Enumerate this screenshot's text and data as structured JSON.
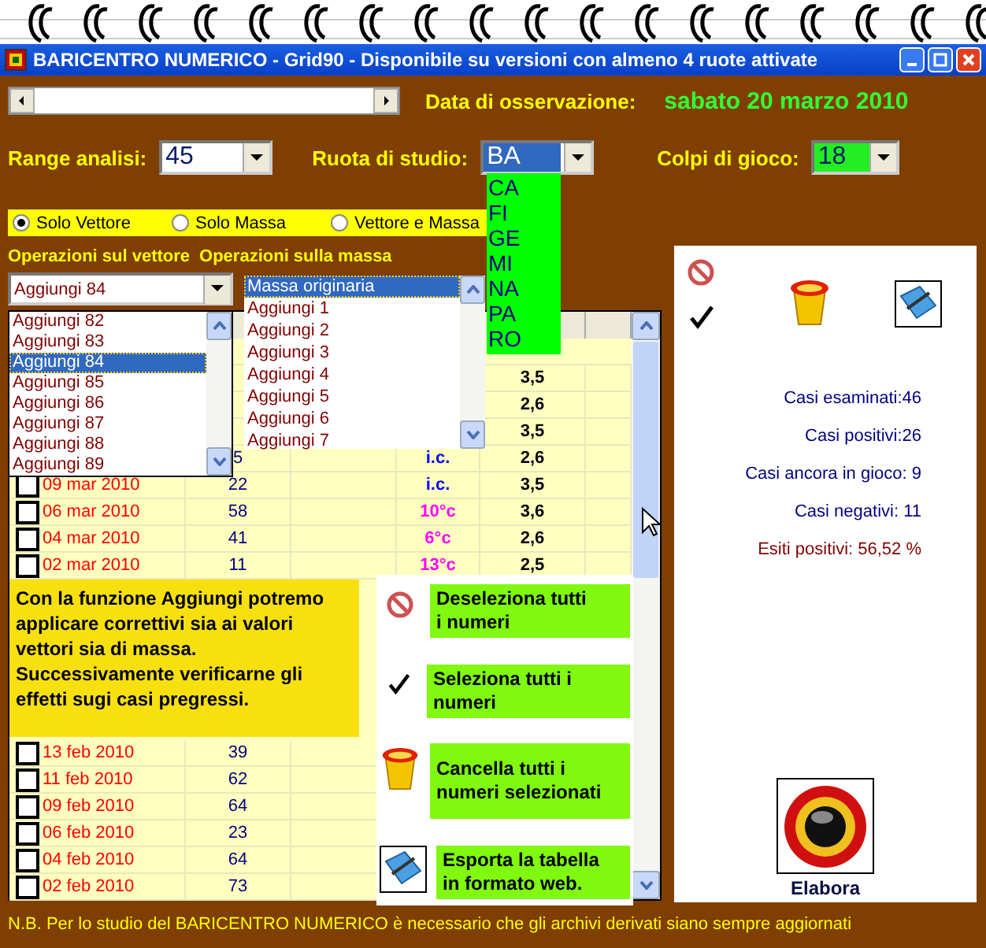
{
  "window": {
    "title": "BARICENTRO NUMERICO - Grid90 - Disponibile su versioni con almeno 4 ruote attivate"
  },
  "observation": {
    "label": "Data di osservazione:",
    "value": "sabato 20 marzo 2010"
  },
  "controls": [
    {
      "label": "Range analisi:",
      "value": "45",
      "kind": "plain"
    },
    {
      "label": "Ruota di studio:",
      "value": "BA",
      "kind": "open"
    },
    {
      "label": "Colpi di gioco:",
      "value": "18",
      "kind": "green"
    }
  ],
  "ruota_options": [
    "CA",
    "FI",
    "GE",
    "MI",
    "NA",
    "PA",
    "RO"
  ],
  "modes": [
    {
      "label": "Solo Vettore",
      "selected": true
    },
    {
      "label": "Solo Massa",
      "selected": false
    },
    {
      "label": "Vettore e Massa",
      "selected": false
    }
  ],
  "vector_ops": {
    "title": "Operazioni sul vettore",
    "value": "Aggiungi 84",
    "options": [
      {
        "label": "Aggiungi 82",
        "selected": false
      },
      {
        "label": "Aggiungi 83",
        "selected": false
      },
      {
        "label": "Aggiungi 84",
        "selected": true
      },
      {
        "label": "Aggiungi 85",
        "selected": false
      },
      {
        "label": "Aggiungi 86",
        "selected": false
      },
      {
        "label": "Aggiungi 87",
        "selected": false
      },
      {
        "label": "Aggiungi 88",
        "selected": false
      },
      {
        "label": "Aggiungi 89",
        "selected": false
      }
    ]
  },
  "mass_ops": {
    "title": "Operazioni sulla massa",
    "options": [
      {
        "label": "Massa originaria",
        "selected": true
      },
      {
        "label": "Aggiungi 1",
        "selected": false
      },
      {
        "label": "Aggiungi 2",
        "selected": false
      },
      {
        "label": "Aggiungi 3",
        "selected": false
      },
      {
        "label": "Aggiungi 4",
        "selected": false
      },
      {
        "label": "Aggiungi 5",
        "selected": false
      },
      {
        "label": "Aggiungi 6",
        "selected": false
      },
      {
        "label": "Aggiungi 7",
        "selected": false
      }
    ]
  },
  "table": {
    "rows_top": [
      {
        "value": "3,5"
      },
      {
        "value": "2,6"
      },
      {
        "value": "3,5"
      },
      {
        "number": "5",
        "tag": {
          "text": "i.c.",
          "color": "#0000ff"
        },
        "value": "2,6"
      },
      {
        "checked": false,
        "date": "09 mar 2010",
        "number": "22",
        "tag": {
          "text": "i.c.",
          "color": "#0000ff"
        },
        "value": "3,5"
      },
      {
        "checked": false,
        "date": "06 mar 2010",
        "number": "58",
        "tag": {
          "text": "10°c",
          "color": "#ff00ff"
        },
        "value": "3,6"
      },
      {
        "checked": false,
        "date": "04 mar 2010",
        "number": "41",
        "tag": {
          "text": "6°c",
          "color": "#ff00ff"
        },
        "value": "2,6"
      },
      {
        "checked": false,
        "date": "02 mar 2010",
        "number": "11",
        "tag": {
          "text": "13°c",
          "color": "#ff00ff"
        },
        "value": "2,5"
      }
    ],
    "rows_bottom": [
      {
        "checked": false,
        "date": "13 feb 2010",
        "number": "39"
      },
      {
        "checked": false,
        "date": "11 feb 2010",
        "number": "62"
      },
      {
        "checked": false,
        "date": "09 feb 2010",
        "number": "64"
      },
      {
        "checked": false,
        "date": "06 feb 2010",
        "number": "23"
      },
      {
        "checked": false,
        "date": "04 feb 2010",
        "number": "64"
      },
      {
        "checked": false,
        "date": "02 feb 2010",
        "number": "73"
      }
    ]
  },
  "tooltip": {
    "text": "Con la funzione Aggiungi potremo\napplicare correttivi sia ai valori\nvettori sia di massa.\nSuccessivamente verificarne gli\neffetti sugi casi pregressi."
  },
  "actions": [
    {
      "kind": "deselect",
      "label": "Deseleziona tutti\ni numeri"
    },
    {
      "kind": "select",
      "label": "Seleziona tutti i\nnumeri"
    },
    {
      "kind": "delete",
      "label": "Cancella tutti i\nnumeri selezionati"
    },
    {
      "kind": "export",
      "label": "Esporta la tabella\nin formato web."
    }
  ],
  "side_panel": {
    "tools": [
      {
        "kind": "deselect"
      },
      {
        "kind": "select"
      },
      {
        "kind": "delete"
      },
      {
        "kind": "export"
      }
    ],
    "stats": [
      {
        "kind": "count",
        "text": "Casi esaminati:46"
      },
      {
        "kind": "count",
        "text": "Casi positivi:26"
      },
      {
        "kind": "count",
        "text": "Casi ancora in gioco: 9"
      },
      {
        "kind": "count",
        "text": "Casi negativi: 11"
      },
      {
        "kind": "result",
        "text": "Esiti positivi: 56,52 %"
      }
    ],
    "run_button": {
      "label": "Elabora"
    }
  },
  "footer": "N.B. Per lo studio del BARICENTRO NUMERICO è necessario che gli archivi derivati siano sempre aggiornati"
}
